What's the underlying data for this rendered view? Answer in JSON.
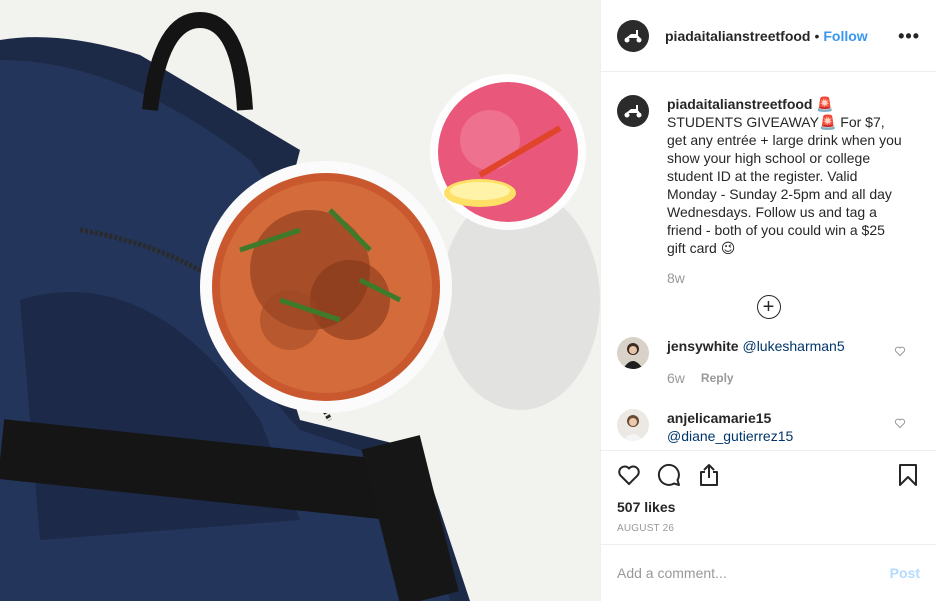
{
  "post": {
    "username": "piadaitalianstreetfood",
    "separator": "•",
    "follow_label": "Follow",
    "more_label": "•••",
    "photo_alt": "Pasta bowl, pink drink and navy backpack"
  },
  "caption": {
    "username": "piadaitalianstreetfood",
    "text": "🚨STUDENTS GIVEAWAY🚨 For $7, get any entrée + large drink when you show your high school or college student ID at the register. Valid Monday - Sunday 2-5pm and all day Wednesdays. Follow us and tag a friend - both of you could win a $25 gift card 😉",
    "timestamp": "8w"
  },
  "load_more_label": "+",
  "comments": [
    {
      "username": "jensywhite",
      "text": "@lukesharman5",
      "time": "6w",
      "reply_label": "Reply"
    },
    {
      "username": "anjelicamarie15",
      "text": "@diane_gutierrez15"
    }
  ],
  "likes": "507 likes",
  "date": "AUGUST 26",
  "add_comment": {
    "placeholder": "Add a comment...",
    "post_label": "Post"
  },
  "colors": {
    "link": "#3897f0",
    "mention": "#003569",
    "post_disabled": "#b3dbff"
  }
}
